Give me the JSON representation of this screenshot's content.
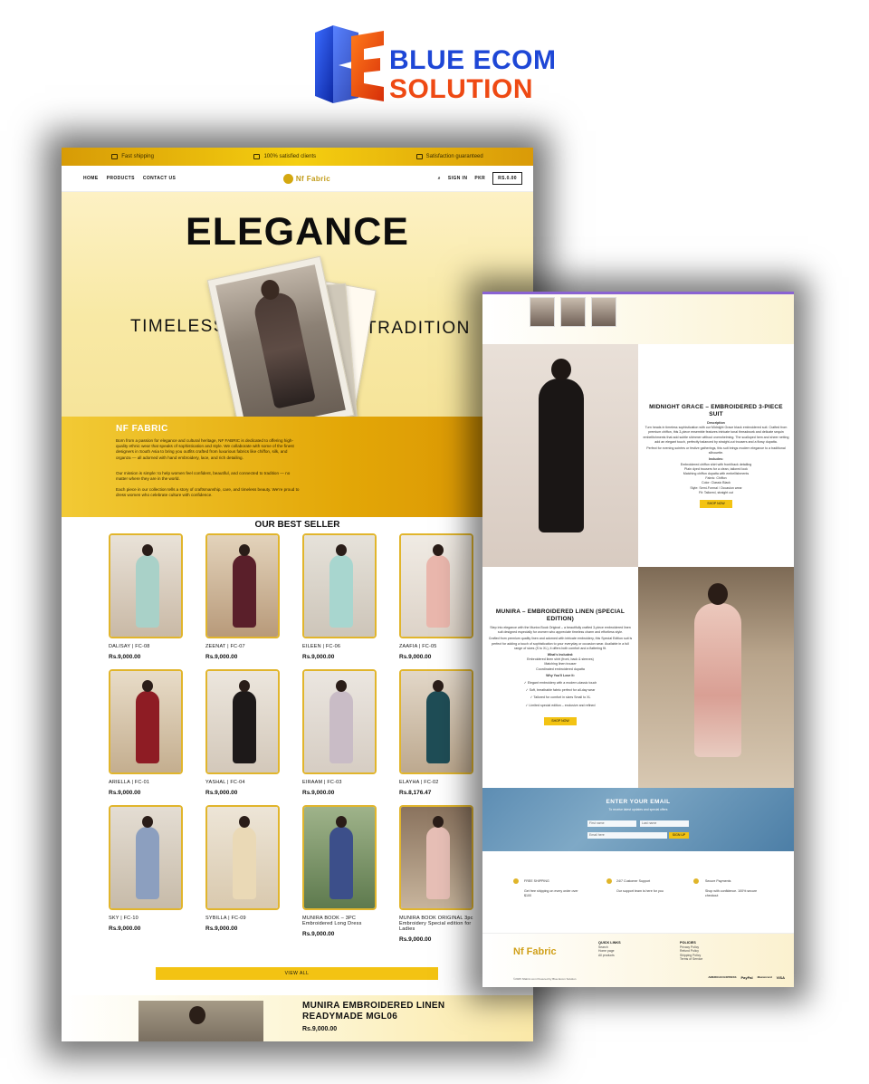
{
  "brand": {
    "line1": "BLUE ECOM",
    "line2": "SOLUTION",
    "colors": {
      "blue": "#1e47d6",
      "orange": "#ef4a14"
    }
  },
  "store": {
    "topbar": [
      "Fast shipping",
      "100% satisfied clients",
      "Satisfaction guaranteed"
    ],
    "nav": {
      "links": [
        "HOME",
        "PRODUCTS",
        "CONTACT US"
      ],
      "logo": "Nf Fabric",
      "sign_in": "SIGN IN",
      "currency": "PKR",
      "cart": "RS.0.00"
    },
    "hero": {
      "title": "ELEGANCE",
      "left": "TIMELESS",
      "right": "TRADITION"
    },
    "about": {
      "heading": "NF FABRIC",
      "p1": "Born from a passion for elegance and cultural heritage, NF FABRIC is dedicated to offering high-quality ethnic wear that speaks of sophistication and style. We collaborate with some of the finest designers in South Asia to bring you outfits crafted from luxurious fabrics like chiffon, silk, and organza — all adorned with hand embroidery, lace, and rich detailing.",
      "p2": "Our mission is simple: to help women feel confident, beautiful, and connected to tradition — no matter where they are in the world.",
      "p3": "Each piece in our collection tells a story of craftsmanship, care, and timeless beauty. We're proud to dress women who celebrate culture with confidence."
    },
    "best_seller_title": "OUR BEST SELLER",
    "products": [
      {
        "name": "DALISAY | FC-08",
        "price": "Rs.9,000.00"
      },
      {
        "name": "ZEENAT | FC-07",
        "price": "Rs.9,000.00"
      },
      {
        "name": "EILEEN | FC-06",
        "price": "Rs.9,000.00"
      },
      {
        "name": "ZAAFIA | FC-05",
        "price": "Rs.9,000.00"
      },
      {
        "name": "ARIELLA | FC-01",
        "price": "Rs.9,000.00"
      },
      {
        "name": "YASHAL | FC-04",
        "price": "Rs.9,000.00"
      },
      {
        "name": "EIRAAM | FC-03",
        "price": "Rs.9,000.00"
      },
      {
        "name": "ELAYHA | FC-02",
        "price": "Rs.8,176.47"
      },
      {
        "name": "SKY | FC-10",
        "price": "Rs.9,000.00"
      },
      {
        "name": "SYBILLA | FC-09",
        "price": "Rs.9,000.00"
      },
      {
        "name": "MUNIRA BOOK – 3PC Embroidered Long Dress",
        "price": "Rs.9,000.00"
      },
      {
        "name": "MUNIRA BOOK ORIGINAL 3pc Embroidery Special edition for Ladies",
        "price": "Rs.9,000.00"
      }
    ],
    "view_all": "VIEW ALL",
    "featured": {
      "title": "MUNIRA EMBROIDERED LINEN READYMADE MGL06",
      "price": "Rs.9,000.00"
    }
  },
  "detail": {
    "p1": {
      "title": "MIDNIGHT GRACE – EMBROIDERED 3-PIECE SUIT",
      "desc_label": "Description",
      "desc": "Turn heads in timeless sophistication with our Midnight Grace black embroidered suit. Crafted from premium chiffon, this 3-piece ensemble features intricate tonal threadwork and delicate sequin embellishments that add subtle shimmer without overwhelming. The scalloped hem and sheer netting add an elegant touch, perfectly balanced by straight-cut trousers and a flowy dupatta.",
      "perfect": "Perfect for evening soirées or festive gatherings, this suit brings modern elegance to a traditional silhouette.",
      "includes_label": "Includes:",
      "includes": [
        "Embroidered chiffon shirt with front/back detailing",
        "Plain dyed trousers for a clean, tailored look",
        "Matching chiffon dupatta with embellishments"
      ],
      "fabric": "Fabric: Chiffon",
      "color": "Color: Classic Black",
      "style": "Style: Semi-Formal / Occasion wear",
      "fit": "Fit: Tailored, straight cut",
      "button": "SHOP NOW"
    },
    "p2": {
      "title": "MUNIRA – EMBROIDERED LINEN (SPECIAL EDITION)",
      "desc": "Step into elegance with the Munira Book Original – a beautifully crafted 3-piece embroidered linen suit designed especially for women who appreciate timeless charm and effortless style.",
      "desc2": "Crafted from premium quality linen and adorned with intricate embroidery, this Special Edition suit is perfect for adding a touch of sophistication to your everyday or occasion wear. Available in a full range of sizes (S to XL), it offers both comfort and a flattering fit.",
      "included_label": "What's Included:",
      "included": [
        "Embroidered linen shirt (front, back & sleeves)",
        "Matching linen trouser",
        "Coordinated embroidered dupatta"
      ],
      "love_label": "Why You'll Love It:",
      "love": [
        "✓ Elegant embroidery with a modern-classic touch",
        "✓ Soft, breathable fabric perfect for all-day wear",
        "✓ Tailored for comfort in sizes Small to XL",
        "✓ Limited special edition – exclusive and refined"
      ],
      "button": "SHOP NOW"
    },
    "newsletter": {
      "title": "ENTER YOUR EMAIL",
      "sub": "To receive latest updates and special offers",
      "first": "First name",
      "last": "Last name",
      "email": "Email here",
      "button": "SIGN UP"
    },
    "features": [
      {
        "title": "FREE SHIPPING",
        "text": "Get free shipping on every order over $100"
      },
      {
        "title": "24/7 Customer Support",
        "text": "Our support team is here for you"
      },
      {
        "title": "Secure Payments",
        "text": "Shop with confidence. 100% secure checkout"
      }
    ],
    "footer": {
      "logo": "Nf Fabric",
      "quick_title": "QUICK LINKS",
      "quick": [
        "Search",
        "Home page",
        "All products"
      ],
      "policy_title": "POLICIES",
      "policy": [
        "Privacy Policy",
        "Refund Policy",
        "Shipping Policy",
        "Terms of Service"
      ],
      "copyright": "©2025 Nfabric.com Powered by Blue Ecom Solution",
      "payments": [
        "AMERICAN EXPRESS",
        "PayPal",
        "Mastercard",
        "VISA"
      ]
    }
  }
}
